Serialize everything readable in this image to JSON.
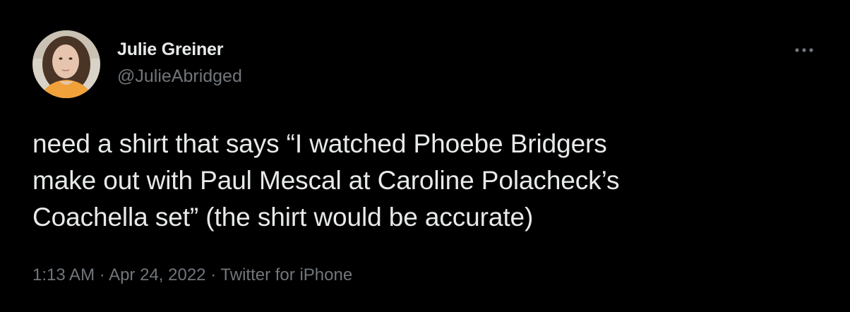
{
  "author": {
    "display_name": "Julie Greiner",
    "handle": "@JulieAbridged",
    "avatar_alt": "avatar"
  },
  "tweet": {
    "text": "need a shirt that says “I watched Phoebe Bridgers\nmake out with Paul Mescal at Caroline Polacheck’s\nCoachella set” (the shirt would be accurate)"
  },
  "meta": {
    "time": "1:13 AM",
    "separator": "·",
    "date": "Apr 24, 2022",
    "source": "Twitter for iPhone"
  },
  "icons": {
    "more": "more-horizontal-icon"
  },
  "colors": {
    "background": "#000000",
    "primary_text": "#e7e9ea",
    "secondary_text": "#71767b"
  }
}
